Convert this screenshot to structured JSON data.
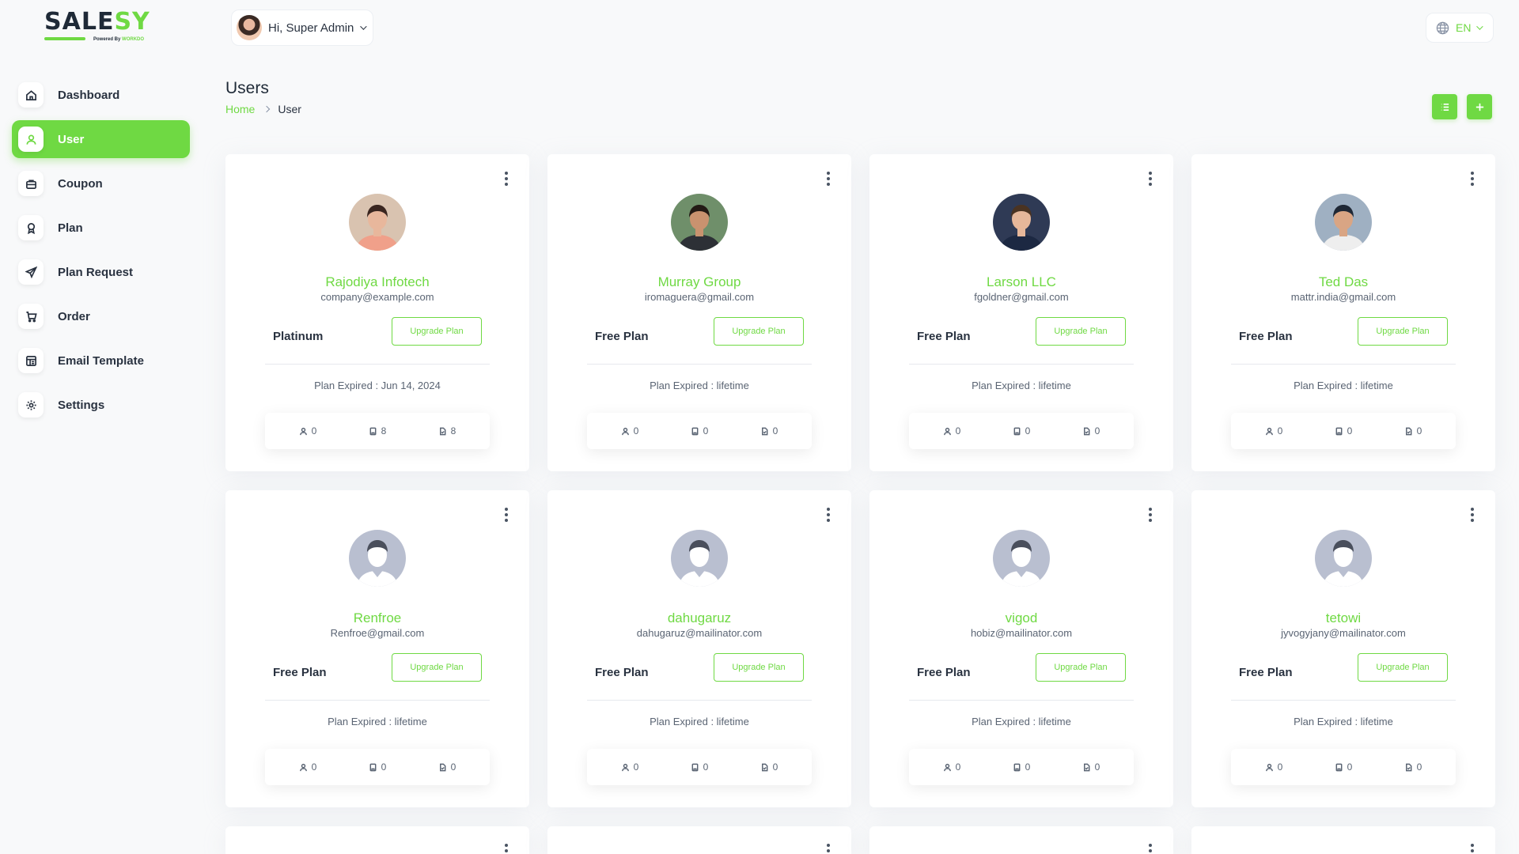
{
  "brand": {
    "name_part1": "SALE",
    "name_part2": "SY",
    "tagline_prefix": "Powered By",
    "tagline_brand": "WORKDO"
  },
  "colors": {
    "accent": "#6fd943",
    "text": "#293240",
    "muted": "#5a6473"
  },
  "header": {
    "greeting": "Hi, Super Admin",
    "language": "EN"
  },
  "sidebar": {
    "items": [
      {
        "label": "Dashboard",
        "icon": "home-icon",
        "active": false
      },
      {
        "label": "User",
        "icon": "user-icon",
        "active": true
      },
      {
        "label": "Coupon",
        "icon": "briefcase-icon",
        "active": false
      },
      {
        "label": "Plan",
        "icon": "award-icon",
        "active": false
      },
      {
        "label": "Plan Request",
        "icon": "send-icon",
        "active": false
      },
      {
        "label": "Order",
        "icon": "cart-icon",
        "active": false
      },
      {
        "label": "Email Template",
        "icon": "template-icon",
        "active": false
      },
      {
        "label": "Settings",
        "icon": "gear-icon",
        "active": false
      }
    ]
  },
  "page": {
    "title": "Users",
    "breadcrumb_home": "Home",
    "breadcrumb_current": "User"
  },
  "users": [
    {
      "name": "Rajodiya Infotech",
      "email": "company@example.com",
      "plan": "Platinum",
      "upgrade_label": "Upgrade Plan",
      "expiry": "Plan Expired : Jun 14, 2024",
      "stat_users": "0",
      "stat_a": "8",
      "stat_b": "8",
      "avatar": "photo-woman"
    },
    {
      "name": "Murray Group",
      "email": "iromaguera@gmail.com",
      "plan": "Free Plan",
      "upgrade_label": "Upgrade Plan",
      "expiry": "Plan Expired : lifetime",
      "stat_users": "0",
      "stat_a": "0",
      "stat_b": "0",
      "avatar": "photo-man-sunglasses"
    },
    {
      "name": "Larson LLC",
      "email": "fgoldner@gmail.com",
      "plan": "Free Plan",
      "upgrade_label": "Upgrade Plan",
      "expiry": "Plan Expired : lifetime",
      "stat_users": "0",
      "stat_a": "0",
      "stat_b": "0",
      "avatar": "photo-man-suit"
    },
    {
      "name": "Ted Das",
      "email": "mattr.india@gmail.com",
      "plan": "Free Plan",
      "upgrade_label": "Upgrade Plan",
      "expiry": "Plan Expired : lifetime",
      "stat_users": "0",
      "stat_a": "0",
      "stat_b": "0",
      "avatar": "photo-man-cap"
    },
    {
      "name": "Renfroe",
      "email": "Renfroe@gmail.com",
      "plan": "Free Plan",
      "upgrade_label": "Upgrade Plan",
      "expiry": "Plan Expired : lifetime",
      "stat_users": "0",
      "stat_a": "0",
      "stat_b": "0",
      "avatar": "default"
    },
    {
      "name": "dahugaruz",
      "email": "dahugaruz@mailinator.com",
      "plan": "Free Plan",
      "upgrade_label": "Upgrade Plan",
      "expiry": "Plan Expired : lifetime",
      "stat_users": "0",
      "stat_a": "0",
      "stat_b": "0",
      "avatar": "default"
    },
    {
      "name": "vigod",
      "email": "hobiz@mailinator.com",
      "plan": "Free Plan",
      "upgrade_label": "Upgrade Plan",
      "expiry": "Plan Expired : lifetime",
      "stat_users": "0",
      "stat_a": "0",
      "stat_b": "0",
      "avatar": "default"
    },
    {
      "name": "tetowi",
      "email": "jyvogyjany@mailinator.com",
      "plan": "Free Plan",
      "upgrade_label": "Upgrade Plan",
      "expiry": "Plan Expired : lifetime",
      "stat_users": "0",
      "stat_a": "0",
      "stat_b": "0",
      "avatar": "default"
    }
  ]
}
